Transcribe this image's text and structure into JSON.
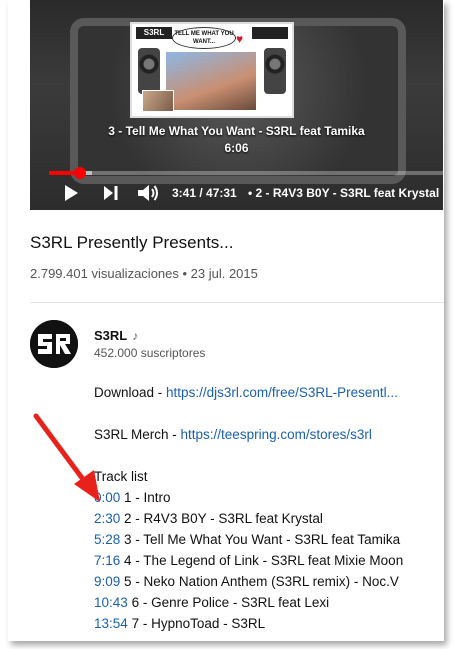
{
  "player": {
    "thumb_logo_left": "S3RL",
    "thumb_logo_right": "",
    "thumb_bubble": "TELL ME WHAT YOU WANT...",
    "now_playing_title": "3 - Tell Me What You Want - S3RL feat Tamika",
    "now_playing_time": "6:06",
    "current_time": "3:41 / 47:31",
    "chapter": "• 2 - R4V3 B0Y - S3RL feat Krystal",
    "progress_fraction": 0.078,
    "buffer_fraction": 0.11,
    "accent_color": "#ff0000"
  },
  "video": {
    "title": "S3RL Presently Presents...",
    "meta": "2.799.401 visualizaciones • 23 jul. 2015"
  },
  "channel": {
    "name": "S3RL",
    "music_note": "♪",
    "subscribers": "452.000 suscriptores"
  },
  "description": {
    "download_label": "Download - ",
    "download_link": "https://djs3rl.com/free/S3RL-Presentl...",
    "merch_label": "S3RL Merch - ",
    "merch_link": "https://teespring.com/stores/s3rl",
    "tracklist_heading": "Track list",
    "tracks": [
      {
        "time": "0:00",
        "label": "1 - Intro"
      },
      {
        "time": "2:30",
        "label": "2 - R4V3 B0Y - S3RL feat Krystal"
      },
      {
        "time": "5:28",
        "label": "3 - Tell Me What You Want - S3RL feat Tamika"
      },
      {
        "time": "7:16",
        "label": "4 - The Legend of Link - S3RL feat Mixie Moon"
      },
      {
        "time": "9:09",
        "label": "5 - Neko Nation Anthem (S3RL remix) - Noc.V"
      },
      {
        "time": "10:43",
        "label": "6 - Genre Police - S3RL feat Lexi"
      },
      {
        "time": "13:54",
        "label": "7 - HypnoToad - S3RL"
      }
    ],
    "link_color": "#1a5fb4"
  },
  "annotation": {
    "arrow_color": "#e8221b"
  }
}
